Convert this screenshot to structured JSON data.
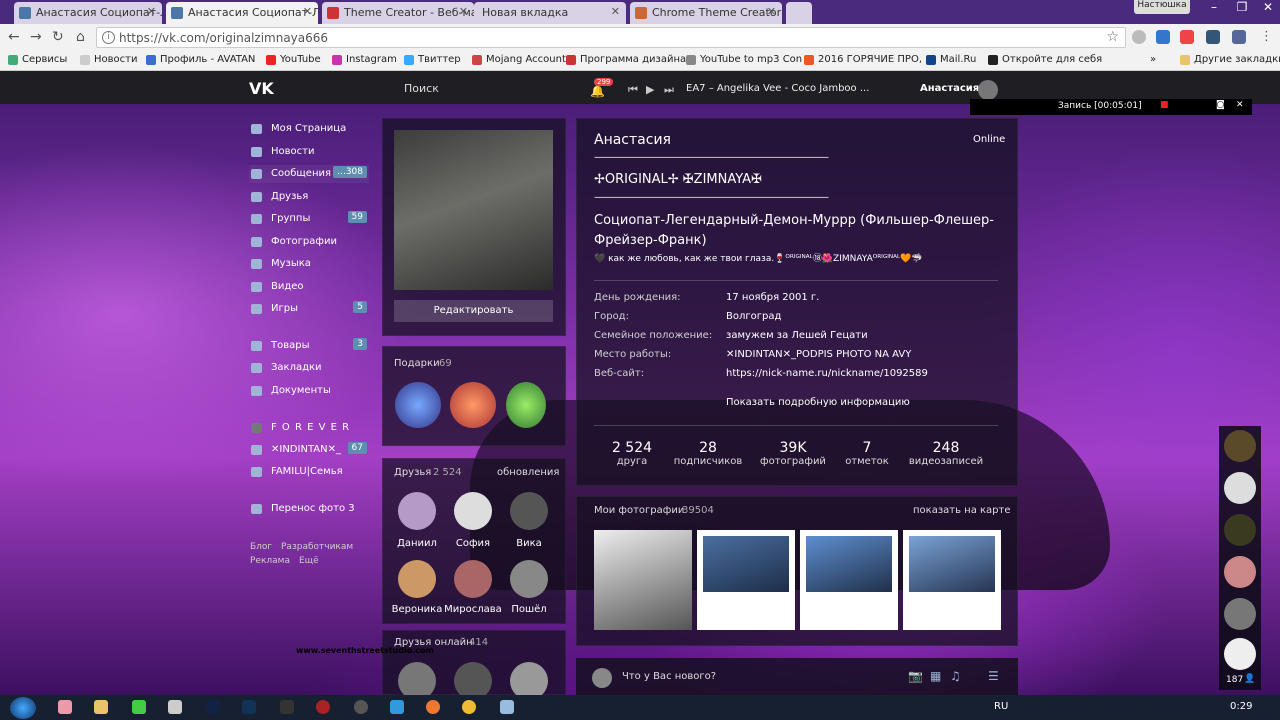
{
  "browser": {
    "tabs": [
      "Анастасия Социопат-Ле",
      "Анастасия Социопат-Ле",
      "Theme Creator - Веб-ма",
      "Новая вкладка",
      "Chrome Theme Creator"
    ],
    "profile_chip": "Настюшка",
    "url": "https://vk.com/originalzimnaya666",
    "bookmarks": [
      "Сервисы",
      "Новости",
      "Профиль - AVATAN",
      "YouTube",
      "Instagram",
      "Твиттер",
      "Mojang Account",
      "Программа дизайна",
      "YouTube to mp3 Con",
      "2016 ГОРЯЧИЕ ПРО,",
      "Mail.Ru",
      "Откройте для себя",
      "Другие закладки"
    ],
    "overflow": "»"
  },
  "vk": {
    "logo": "VK",
    "search": "Поиск",
    "notif_count": "299",
    "track": "EA7 – Angelika Vee - Coco Jamboo ...",
    "user": "Анастасия",
    "recording": "Запись [00:05:01]"
  },
  "menu": {
    "items": [
      {
        "label": "Моя Страница",
        "count": ""
      },
      {
        "label": "Новости",
        "count": ""
      },
      {
        "label": "Сообщения",
        "count": "...308"
      },
      {
        "label": "Друзья",
        "count": ""
      },
      {
        "label": "Группы",
        "count": "59"
      },
      {
        "label": "Фотографии",
        "count": ""
      },
      {
        "label": "Музыка",
        "count": ""
      },
      {
        "label": "Видео",
        "count": ""
      },
      {
        "label": "Игры",
        "count": "5"
      }
    ],
    "items2": [
      {
        "label": "Товары",
        "count": "3"
      },
      {
        "label": "Закладки",
        "count": ""
      },
      {
        "label": "Документы",
        "count": ""
      }
    ],
    "group_header": "F O R E V E R",
    "groups": [
      {
        "label": "✕INDINTAN✕_",
        "count": "67"
      },
      {
        "label": "FAMILU|Семья",
        "count": ""
      }
    ],
    "transfer": "Перенос фото 3",
    "footer": [
      "Блог",
      "Разработчикам",
      "Реклама",
      "Ещё"
    ]
  },
  "profile": {
    "edit": "Редактировать",
    "gifts_label": "Подарки",
    "gifts_count": "69",
    "friends_label": "Друзья",
    "friends_count": "2 524",
    "friends_updates": "обновления",
    "friends": [
      "Даниил",
      "София",
      "Вика",
      "Вероника",
      "Мирослава",
      "Пошёл"
    ],
    "friends_online_label": "Друзья онлайн",
    "friends_online_count": "414",
    "name": "Анастасия",
    "online": "Online",
    "line1": "——————————————————————————",
    "title1": "✢ORIGINAL✢ ✠ZIMNAYA✠",
    "line2": "——————————————————————————",
    "status": "Социопат-Легендарный-Демон-Муррр (Фильшер-Флешер-Фрейзер-Франк)",
    "substatus": "🖤 как же любовь, как же твои глаза.🍷ᴼᴿᴵᴳᴵᴺᴬᴸ⑱🌺ZIMNAYAᴼᴿᴵᴳᴵᴺᴬᴸ🧡🦈",
    "fields": [
      {
        "k": "День рождения:",
        "v": "17 ноября 2001 г."
      },
      {
        "k": "Город:",
        "v": "Волгоград"
      },
      {
        "k": "Семейное положение:",
        "v": "замужем за Лешей Гецати"
      },
      {
        "k": "Место работы:",
        "v": "✕INDINTAN✕_PODPIS PHOTO NA AVY"
      },
      {
        "k": "Веб-сайт:",
        "v": "https://nick-name.ru/nickname/1092589"
      }
    ],
    "more": "Показать подробную информацию",
    "stats": [
      {
        "n": "2 524",
        "l": "друга"
      },
      {
        "n": "28",
        "l": "подписчиков"
      },
      {
        "n": "39K",
        "l": "фотографий"
      },
      {
        "n": "7",
        "l": "отметок"
      },
      {
        "n": "248",
        "l": "видеозаписей"
      }
    ],
    "photos_label": "Мои фотографии",
    "photos_count": "39504",
    "map": "показать на карте",
    "compose": "Что у Вас нового?",
    "watermark": "www.seventhstreetstudio.com"
  },
  "rail": {
    "count": "187"
  },
  "taskbar": {
    "lang": "RU",
    "time": "0:29"
  }
}
